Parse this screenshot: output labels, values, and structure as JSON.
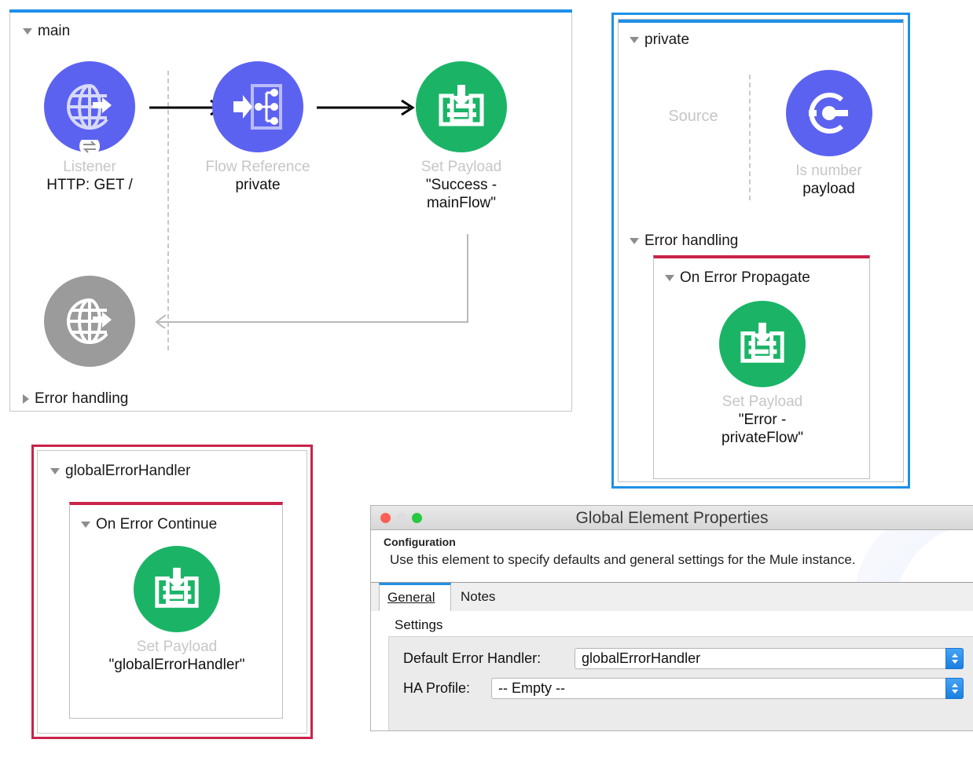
{
  "canvas": {
    "colors": {
      "accent_blue": "#1e90e8",
      "error_red": "#c9234a",
      "node_purple": "#5c62f0",
      "node_green": "#1bb467",
      "node_grey": "#9b9b9b",
      "muted_text": "#c6c6c6"
    }
  },
  "main_flow": {
    "title": "main",
    "nodes": [
      {
        "type": "Listener",
        "name": "HTTP: GET /",
        "icon": "globe-arrow-icon",
        "color": "purple"
      },
      {
        "type": "Flow Reference",
        "name": "private",
        "icon": "flow-reference-icon",
        "color": "purple"
      },
      {
        "type": "Set Payload",
        "name": "\"Success -\nmainFlow\"",
        "icon": "set-payload-icon",
        "color": "green"
      }
    ],
    "response_node": {
      "type": "",
      "name": "",
      "icon": "globe-arrow-icon",
      "color": "grey"
    },
    "error_handling": {
      "label": "Error handling",
      "expanded": false
    }
  },
  "private_flow": {
    "title": "private",
    "source_placeholder": "Source",
    "nodes": [
      {
        "type": "Is number",
        "name": "payload",
        "icon": "validator-icon",
        "color": "purple"
      }
    ],
    "error_handling": {
      "label": "Error handling",
      "expanded": true,
      "handler": {
        "title": "On Error Propagate",
        "node": {
          "type": "Set Payload",
          "name": "\"Error -\nprivateFlow\"",
          "icon": "set-payload-icon",
          "color": "green"
        }
      }
    }
  },
  "global_error_handler": {
    "title": "globalErrorHandler",
    "handler": {
      "title": "On Error Continue",
      "node": {
        "type": "Set Payload",
        "name": "\"globalErrorHandler\"",
        "icon": "set-payload-icon",
        "color": "green"
      }
    }
  },
  "dialog": {
    "window_title": "Global Element Properties",
    "traffic_lights": [
      "close",
      "minimize",
      "zoom"
    ],
    "section_label": "Configuration",
    "description": "Use this element to specify defaults and general settings for the Mule instance.",
    "tabs": [
      {
        "label": "General",
        "active": true
      },
      {
        "label": "Notes",
        "active": false
      }
    ],
    "settings_label": "Settings",
    "fields": [
      {
        "label": "Default Error Handler:",
        "value": "globalErrorHandler",
        "control": "combo-box"
      },
      {
        "label": "HA Profile:",
        "value": "-- Empty --",
        "control": "combo-box"
      }
    ]
  }
}
